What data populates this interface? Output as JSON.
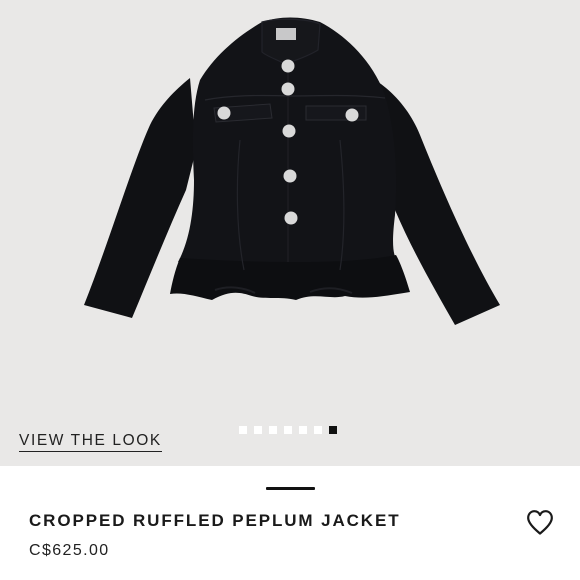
{
  "gallery": {
    "image_alt": "Black cropped ruffled peplum jacket with silver buttons",
    "view_the_look": "VIEW THE LOOK",
    "page_count": 7,
    "active_page": 7
  },
  "product": {
    "title": "CROPPED RUFFLED PEPLUM JACKET",
    "price": "C$625.00"
  },
  "icons": {
    "favorite": "heart-outline-icon"
  },
  "colors": {
    "gallery_bg": "#e9e8e7",
    "text": "#1a1a1a",
    "jacket": "#111215",
    "active_dot": "#111111"
  }
}
